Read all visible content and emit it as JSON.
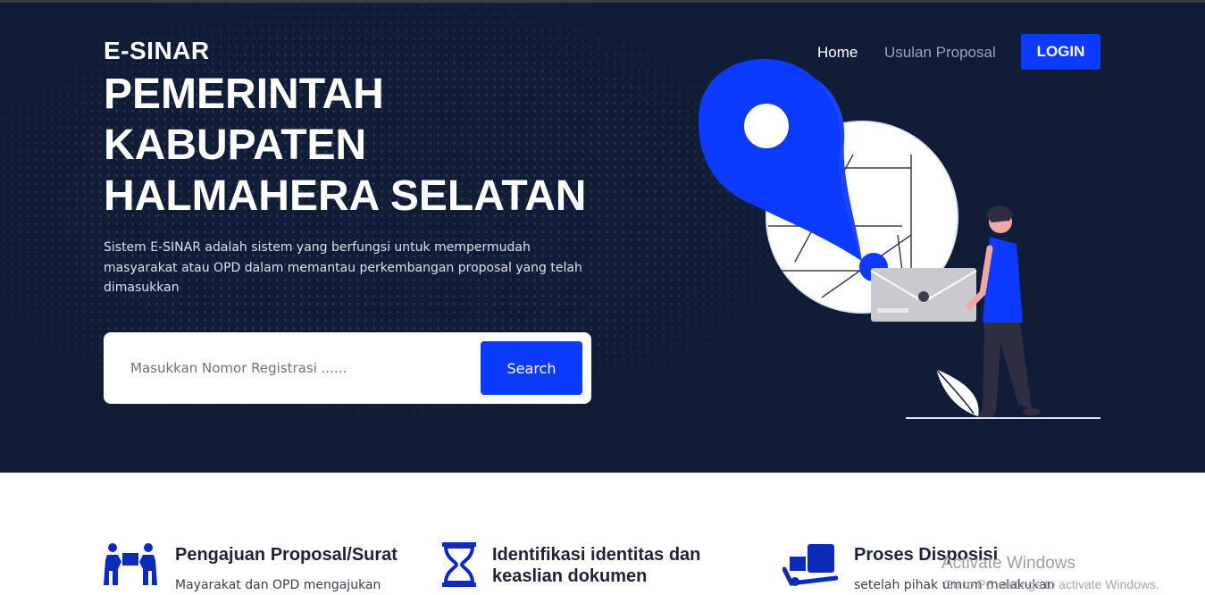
{
  "app": {
    "brand": "E-SINAR",
    "title_lines": [
      "PEMERINTAH",
      "KABUPATEN",
      "HALMAHERA SELATAN"
    ],
    "description": "Sistem E-SINAR adalah sistem yang berfungsi untuk mempermudah masyarakat atau OPD dalam memantau perkembangan proposal yang telah dimasukkan"
  },
  "nav": {
    "home": "Home",
    "usulan": "Usulan Proposal",
    "login": "LOGIN"
  },
  "search": {
    "placeholder": "Masukkan Nomor Registrasi ......",
    "button": "Search"
  },
  "features": [
    {
      "icon": "people-carry-icon",
      "title": "Pengajuan Proposal/Surat",
      "text": "Mayarakat dan OPD mengajukan"
    },
    {
      "icon": "hourglass-icon",
      "title_line1": "Identifikasi identitas dan",
      "title_line2": "keaslian dokumen"
    },
    {
      "icon": "dolly-icon",
      "title": "Proses Disposisi",
      "text": "setelah pihak umum melakukan"
    }
  ],
  "watermark": {
    "title": "Activate Windows",
    "subtitle": "Go to PC settings to activate Windows."
  },
  "colors": {
    "hero_bg": "#111c36",
    "accent": "#0d3aff"
  }
}
